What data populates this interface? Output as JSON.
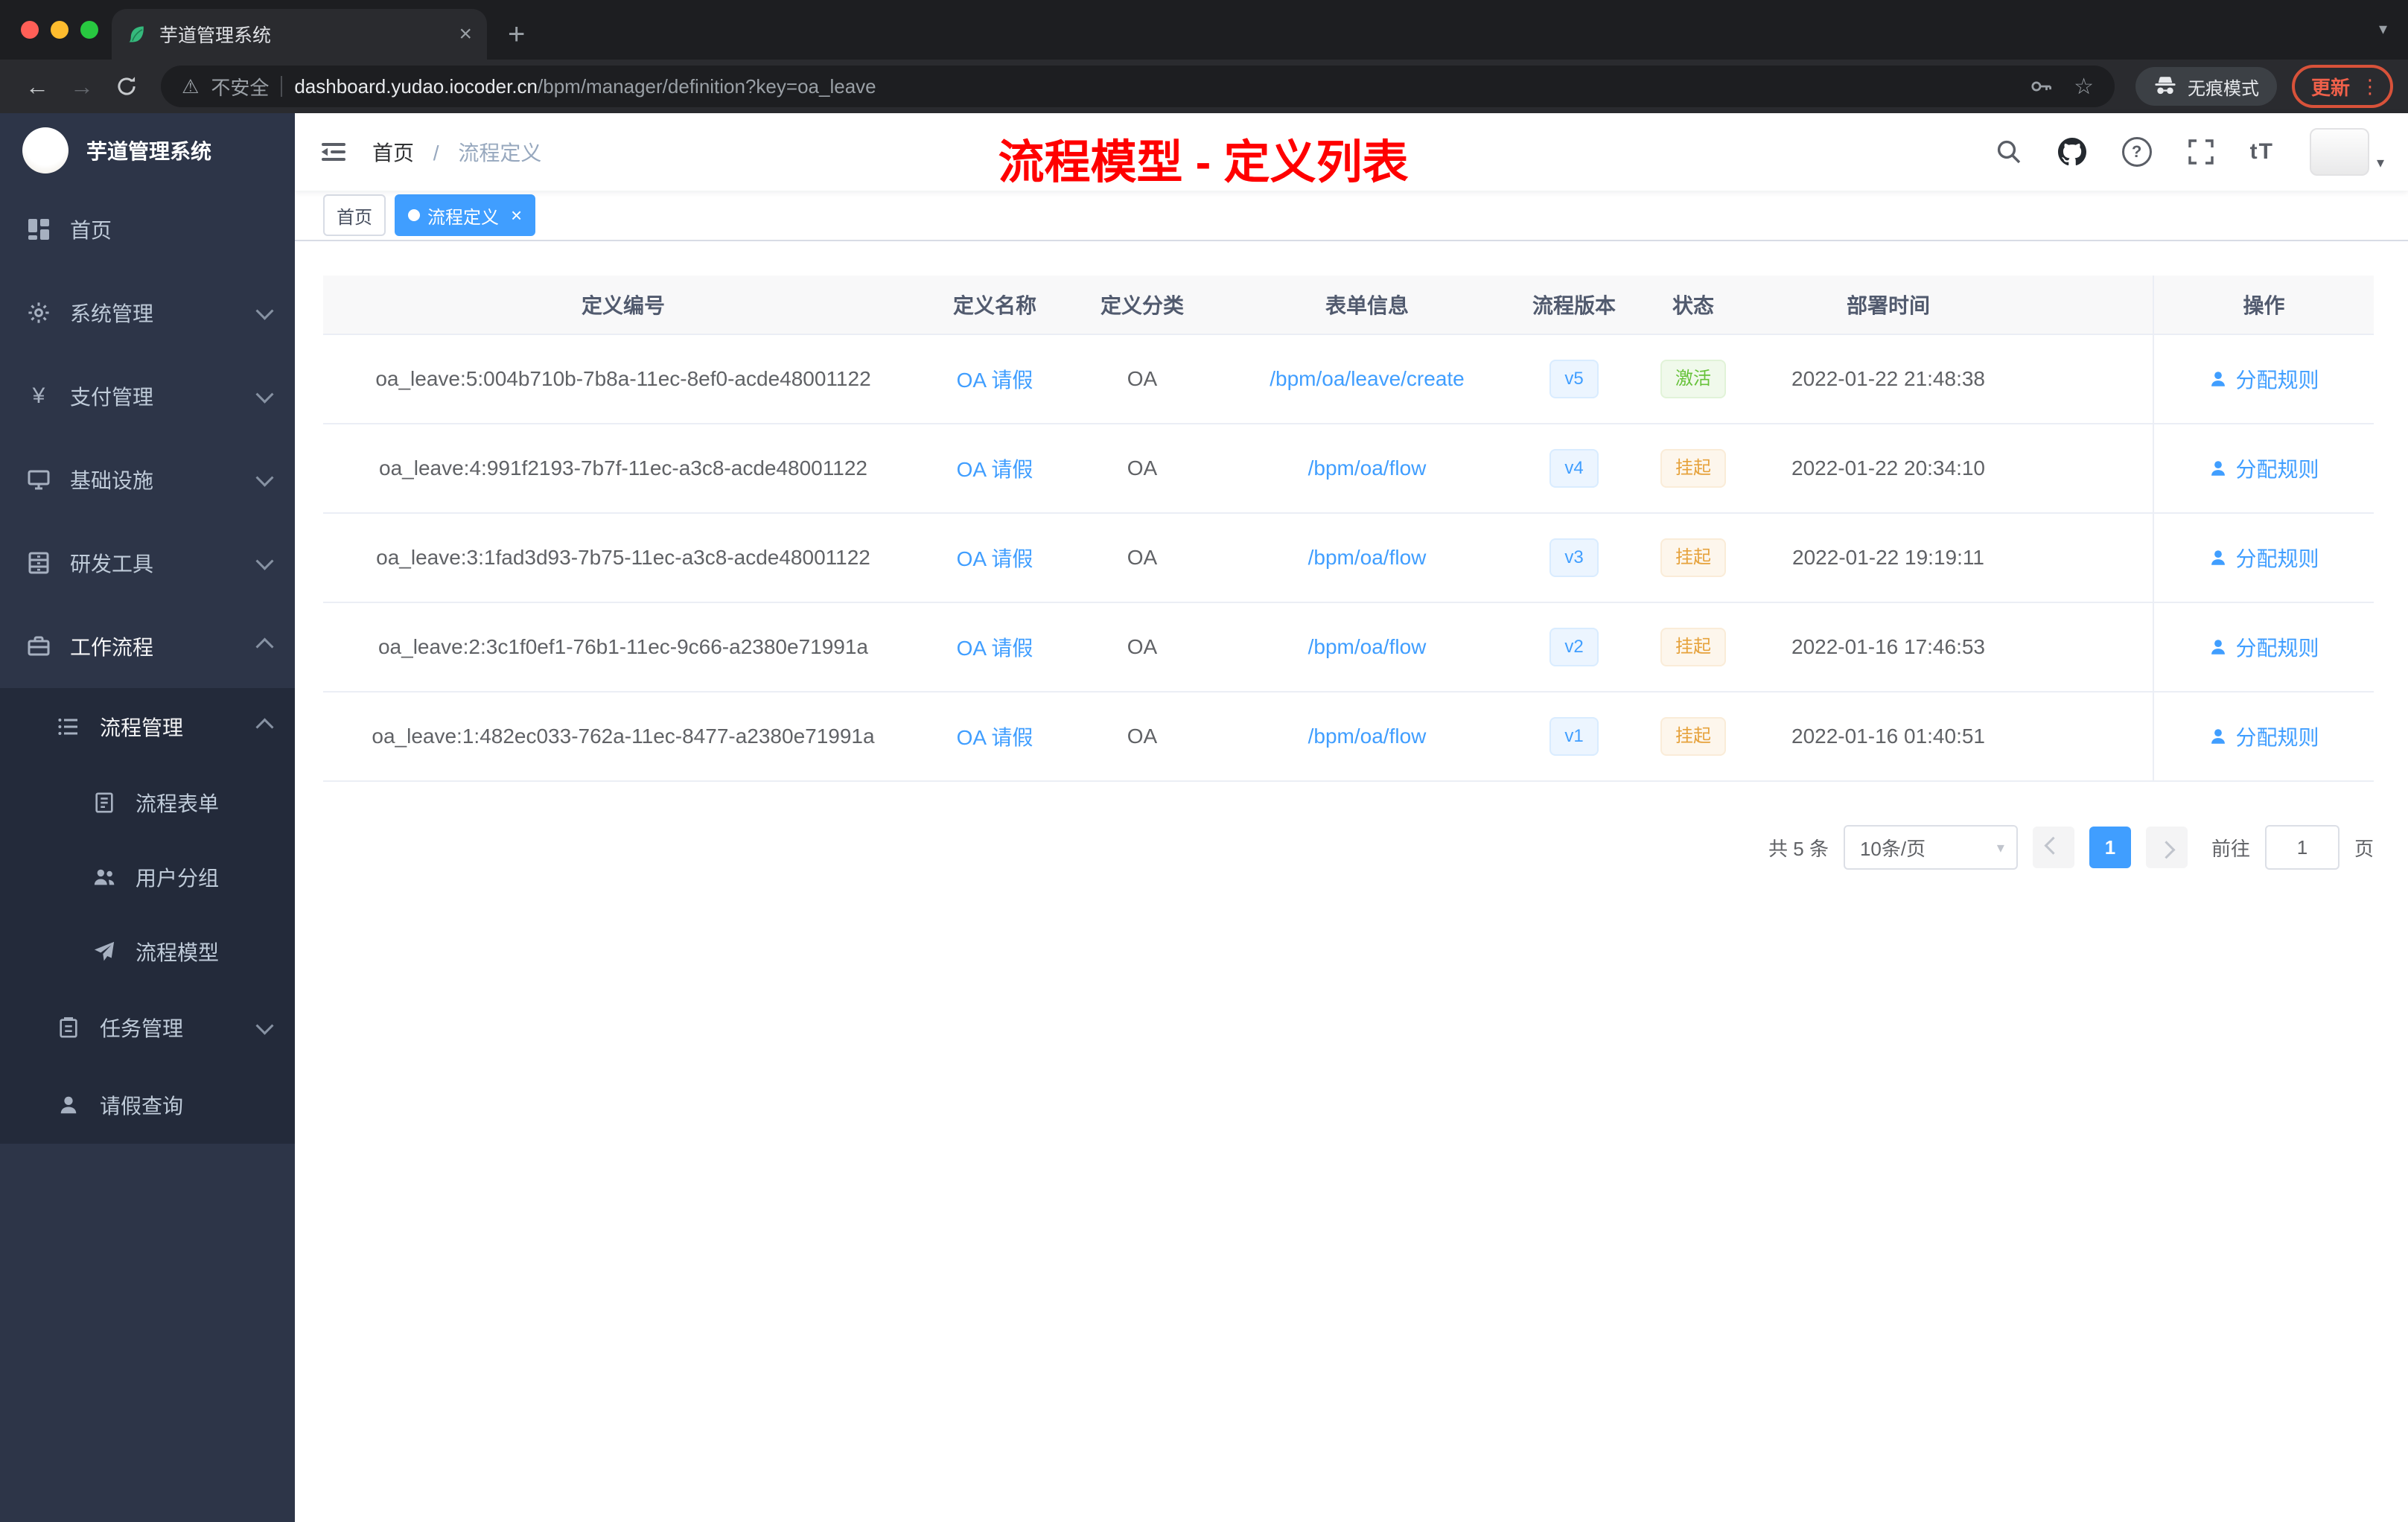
{
  "colors": {
    "primary": "#409eff",
    "success": "#67c23a",
    "warning": "#e6a23c",
    "annotation_red": "#ff0000",
    "sidebar_bg": "#2d3548",
    "submenu_bg": "#232a3a"
  },
  "icons": {
    "close": "×",
    "plus": "+",
    "caret_down": "▾",
    "warning": "⚠",
    "star": "☆",
    "back": "←",
    "forward": "→",
    "dots": "⋮",
    "help": "?",
    "font_size": "tT",
    "yen": "¥",
    "omnibox_divider": ""
  },
  "browser": {
    "tab_title": "芋道管理系统",
    "security_label": "不安全",
    "url_host": "dashboard.yudao.iocoder.cn",
    "url_path": "/bpm/manager/definition?key=oa_leave",
    "incognito_label": "无痕模式",
    "update_label": "更新"
  },
  "sidebar": {
    "logo_title": "芋道管理系统",
    "items": [
      {
        "label": "首页"
      },
      {
        "label": "系统管理"
      },
      {
        "label": "支付管理"
      },
      {
        "label": "基础设施"
      },
      {
        "label": "研发工具"
      },
      {
        "label": "工作流程"
      },
      {
        "label": "流程管理"
      },
      {
        "label": "流程表单"
      },
      {
        "label": "用户分组"
      },
      {
        "label": "流程模型"
      },
      {
        "label": "任务管理"
      },
      {
        "label": "请假查询"
      }
    ]
  },
  "navbar": {
    "breadcrumb_home": "首页",
    "breadcrumb_sep": "/",
    "breadcrumb_current": "流程定义",
    "annotation": "流程模型 - 定义列表"
  },
  "tags": {
    "home": "首页",
    "active": "流程定义"
  },
  "table": {
    "columns": [
      "定义编号",
      "定义名称",
      "定义分类",
      "表单信息",
      "流程版本",
      "状态",
      "部署时间",
      "操作"
    ],
    "action_label": "分配规则",
    "rows": [
      {
        "id": "oa_leave:5:004b710b-7b8a-11ec-8ef0-acde48001122",
        "name": "OA 请假",
        "category": "OA",
        "form": "/bpm/oa/leave/create",
        "version": "v5",
        "status": "激活",
        "time": "2022-01-22 21:48:38"
      },
      {
        "id": "oa_leave:4:991f2193-7b7f-11ec-a3c8-acde48001122",
        "name": "OA 请假",
        "category": "OA",
        "form": "/bpm/oa/flow",
        "version": "v4",
        "status": "挂起",
        "time": "2022-01-22 20:34:10"
      },
      {
        "id": "oa_leave:3:1fad3d93-7b75-11ec-a3c8-acde48001122",
        "name": "OA 请假",
        "category": "OA",
        "form": "/bpm/oa/flow",
        "version": "v3",
        "status": "挂起",
        "time": "2022-01-22 19:19:11"
      },
      {
        "id": "oa_leave:2:3c1f0ef1-76b1-11ec-9c66-a2380e71991a",
        "name": "OA 请假",
        "category": "OA",
        "form": "/bpm/oa/flow",
        "version": "v2",
        "status": "挂起",
        "time": "2022-01-16 17:46:53"
      },
      {
        "id": "oa_leave:1:482ec033-762a-11ec-8477-a2380e71991a",
        "name": "OA 请假",
        "category": "OA",
        "form": "/bpm/oa/flow",
        "version": "v1",
        "status": "挂起",
        "time": "2022-01-16 01:40:51"
      }
    ]
  },
  "pagination": {
    "total": "共 5 条",
    "page_size": "10条/页",
    "page": "1",
    "goto": "前往",
    "unit": "页"
  }
}
